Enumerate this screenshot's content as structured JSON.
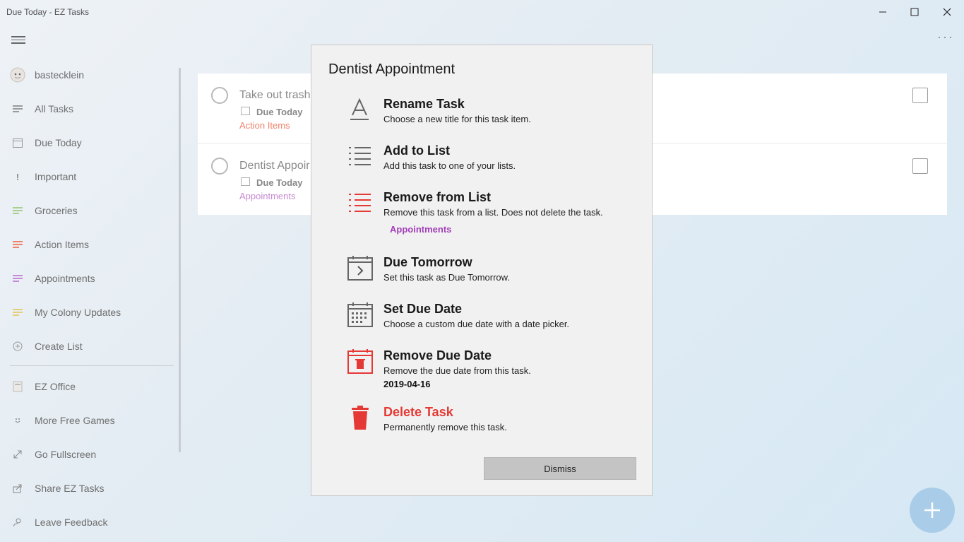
{
  "window": {
    "title": "Due Today - EZ Tasks"
  },
  "colors": {
    "accent_red": "#e53935",
    "appointments_purple": "#a13fb8",
    "action_items_orange": "#f0826a"
  },
  "sidebar": {
    "user": "bastecklein",
    "items": [
      {
        "label": "All Tasks",
        "icon": "lines-icon"
      },
      {
        "label": "Due Today",
        "icon": "calendar-icon"
      },
      {
        "label": "Important",
        "icon": "exclamation-icon"
      },
      {
        "label": "Groceries",
        "icon": "list-icon"
      },
      {
        "label": "Action Items",
        "icon": "list-icon"
      },
      {
        "label": "Appointments",
        "icon": "list-icon"
      },
      {
        "label": "My Colony Updates",
        "icon": "list-icon"
      },
      {
        "label": "Create List",
        "icon": "plus-circle-icon"
      }
    ],
    "extras": [
      {
        "label": "EZ Office",
        "icon": "office-icon"
      },
      {
        "label": "More Free Games",
        "icon": "smiley-icon"
      },
      {
        "label": "Go Fullscreen",
        "icon": "expand-icon"
      },
      {
        "label": "Share EZ Tasks",
        "icon": "share-icon"
      },
      {
        "label": "Leave Feedback",
        "icon": "feedback-icon"
      }
    ]
  },
  "tasks": [
    {
      "title": "Take out trash",
      "due": "Due Today",
      "list": "Action Items"
    },
    {
      "title": "Dentist Appoir",
      "due": "Due Today",
      "list": "Appointments"
    }
  ],
  "dialog": {
    "title": "Dentist Appointment",
    "options": [
      {
        "title": "Rename Task",
        "desc": "Choose a new title for this task item."
      },
      {
        "title": "Add to List",
        "desc": "Add this task to one of your lists."
      },
      {
        "title": "Remove from List",
        "desc": "Remove this task from a list.  Does not delete the task.",
        "extra": "Appointments"
      },
      {
        "title": "Due Tomorrow",
        "desc": "Set this task as Due Tomorrow."
      },
      {
        "title": "Set Due Date",
        "desc": "Choose a custom due date with a date picker."
      },
      {
        "title": "Remove Due Date",
        "desc": "Remove the due date from this task.",
        "extra": "2019-04-16"
      },
      {
        "title": "Delete Task",
        "desc": "Permanently remove this task."
      }
    ],
    "dismiss_label": "Dismiss"
  }
}
